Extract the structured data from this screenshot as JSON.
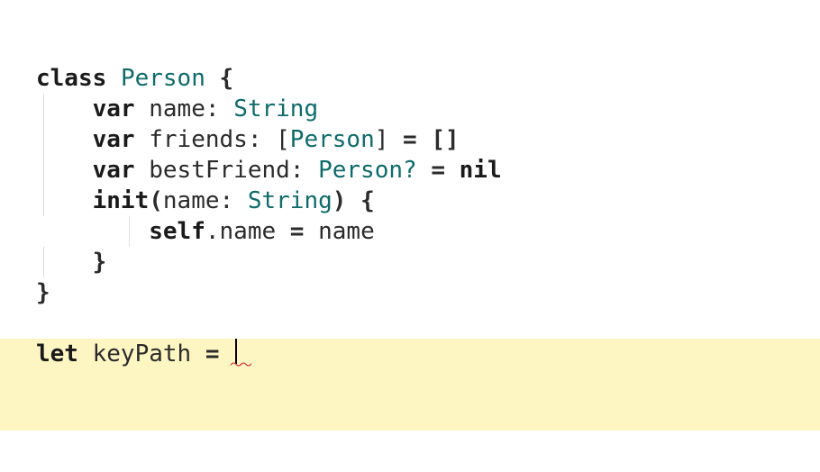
{
  "code": {
    "l1": {
      "class_kw": "class",
      "class_name": "Person",
      "brace_open": " {"
    },
    "l2": {
      "var_kw": "var",
      "name_id": " name",
      "colon": ": ",
      "type": "String"
    },
    "l3": {
      "var_kw": "var",
      "name_id": " friends",
      "colon": ": ",
      "lb": "[",
      "type": "Person",
      "rb": "]",
      "assign": " = []"
    },
    "l4": {
      "var_kw": "var",
      "name_id": " bestFriend",
      "colon": ": ",
      "type": "Person",
      "opt": "?",
      "assign": " = ",
      "nil": "nil"
    },
    "l5": {
      "init_kw": "init",
      "lp": "(",
      "param": "name",
      "colon": ": ",
      "type": "String",
      "rp_brace": ") {"
    },
    "l6": {
      "self_kw": "self",
      "dot_name": ".name",
      "assign": " = ",
      "rhs": "name"
    },
    "l7": {
      "brace_close": "}"
    },
    "l8": {
      "brace_close": "}"
    },
    "l10": {
      "let_kw": "let",
      "name_id": " keyPath",
      "assign": " = "
    },
    "squiggle": "～～"
  }
}
